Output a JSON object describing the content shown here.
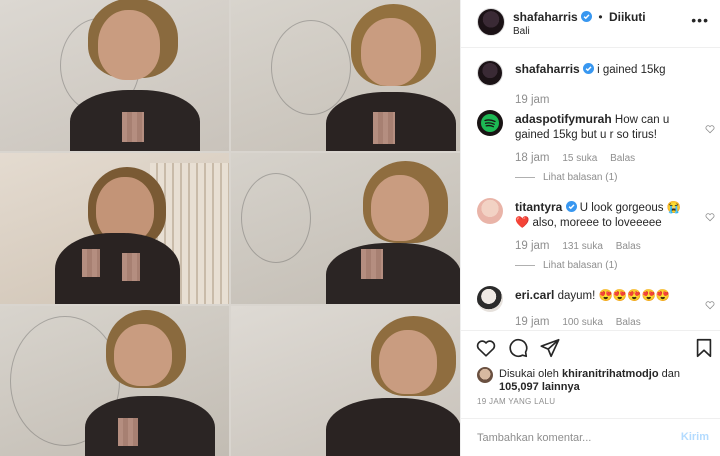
{
  "post": {
    "username": "shafaharris",
    "follow_status": "Diikuti",
    "location": "Bali"
  },
  "comments": [
    {
      "username": "shafaharris",
      "text": "i gained 15kg",
      "time": "19 jam"
    },
    {
      "username": "adaspotifymurah",
      "text": "How can u gained 15kg but u r so tirus!",
      "time": "18 jam",
      "likes": "15 suka",
      "reply": "Balas",
      "view_replies": "Lihat balasan (1)"
    },
    {
      "username": "titantyra",
      "text_a": "U look gorgeous 😭",
      "text_b": "❤️ also, moreee to loveeeee",
      "time": "19 jam",
      "likes": "131 suka",
      "reply": "Balas",
      "view_replies": "Lihat balasan (1)"
    },
    {
      "username": "eri.carl",
      "text": "dayum! 😍😍😍😍😍",
      "time": "19 jam",
      "likes": "100 suka",
      "reply": "Balas"
    }
  ],
  "likes": {
    "prefix": "Disukai oleh",
    "user": "khiranitrihatmodjo",
    "and": "dan",
    "count": "105,097 lainnya"
  },
  "timestamp": "19 JAM YANG LALU",
  "comment_box": {
    "placeholder": "Tambahkan komentar...",
    "post_label": "Kirim"
  },
  "icons": {
    "more": "more-icon",
    "like": "heart-icon",
    "comment": "comment-icon",
    "share": "share-icon",
    "save": "bookmark-icon",
    "verified": "verified-badge-icon"
  },
  "colors": {
    "verified": "#3897f0",
    "spotify": "#1db954",
    "post_disabled": "#b3dbff"
  }
}
